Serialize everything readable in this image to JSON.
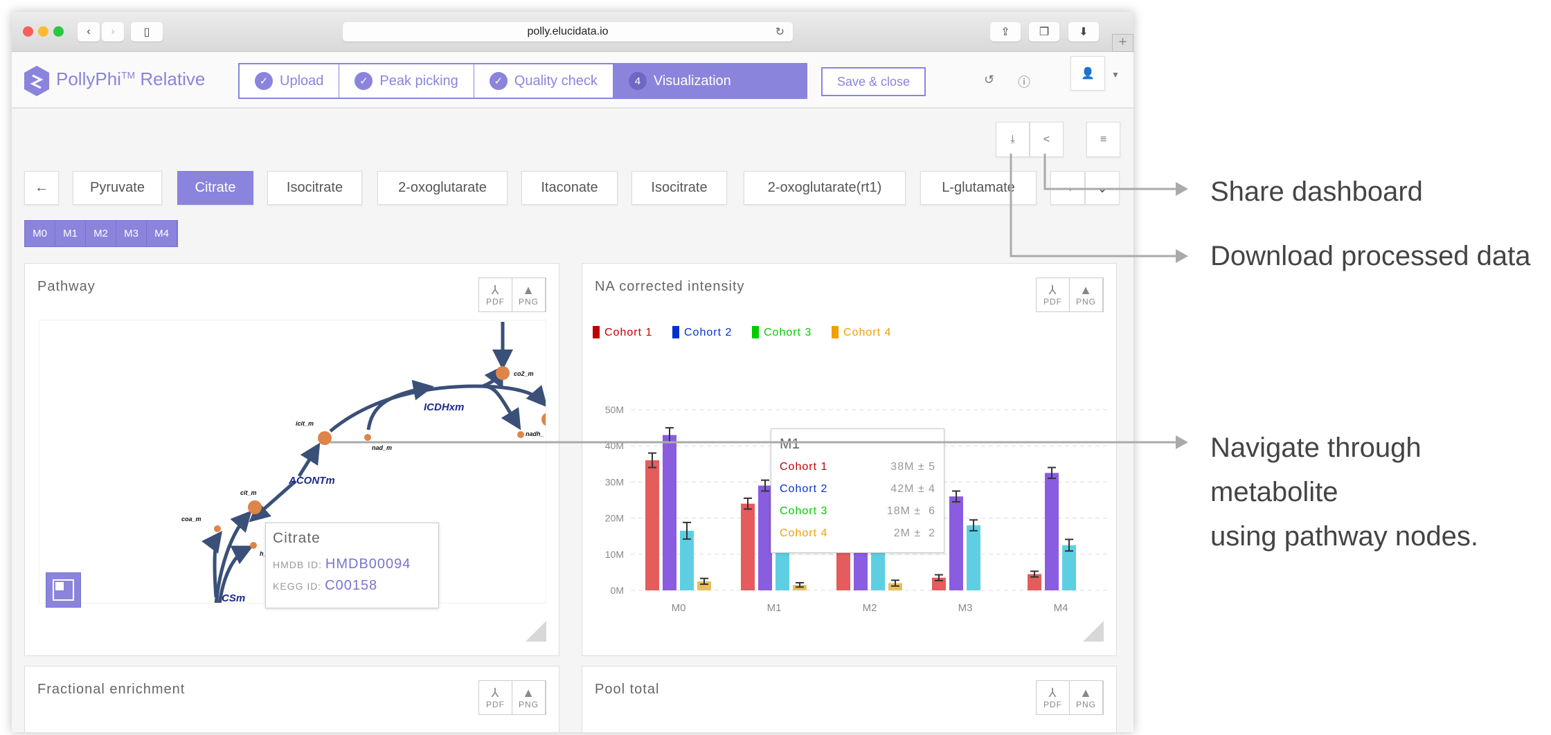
{
  "browser": {
    "url": "polly.elucidata.io",
    "icons": [
      "back-icon",
      "forward-icon",
      "sidebar-icon",
      "reload-icon",
      "share-icon",
      "tabs-icon",
      "download-icon",
      "new-tab-icon"
    ]
  },
  "app": {
    "name": "PollyPhi",
    "sup": "TM",
    "suffix": "Relative",
    "brand_color": "#8a84dc"
  },
  "stepper": [
    {
      "label": "Upload",
      "state": "done"
    },
    {
      "label": "Peak picking",
      "state": "done"
    },
    {
      "label": "Quality check",
      "state": "done"
    },
    {
      "num": "4",
      "label": "Visualization",
      "state": "active"
    }
  ],
  "save_label": "Save & close",
  "metabolites": {
    "items": [
      "Pyruvate",
      "Citrate",
      "Isocitrate",
      "2-oxoglutarate",
      "Itaconate",
      "Isocitrate",
      "2-oxoglutarate(rt1)",
      "L-glutamate"
    ],
    "selected": "Citrate"
  },
  "isotopologues": [
    "M0",
    "M1",
    "M2",
    "M3",
    "M4"
  ],
  "export": {
    "pdf": "PDF",
    "png": "PNG"
  },
  "pathway": {
    "title": "Pathway",
    "nodes": [
      "co2_m",
      "icit_m",
      "cit_m",
      "nad_m",
      "nadh_",
      "coa_m",
      "h_"
    ],
    "reactions": [
      "ICDHxm",
      "ACONTm",
      "CSm"
    ],
    "tooltip": {
      "name": "Citrate",
      "hmdb_label": "HMDB ID:",
      "hmdb": "HMDB00094",
      "kegg_label": "KEGG ID:",
      "kegg": "C00158"
    }
  },
  "na_chart": {
    "title": "NA corrected intensity",
    "tooltip": {
      "title": "M1",
      "rows": [
        {
          "name": "Cohort 1",
          "value": "38M ± 5"
        },
        {
          "name": "Cohort 2",
          "value": "42M ± 4"
        },
        {
          "name": "Cohort 3",
          "value": "18M ±  6"
        },
        {
          "name": "Cohort 4",
          "value": "2M ±  2"
        }
      ]
    }
  },
  "chart_data": {
    "type": "bar",
    "title": "NA corrected intensity",
    "categories": [
      "M0",
      "M1",
      "M2",
      "M3",
      "M4"
    ],
    "yticks": [
      "0M",
      "10M",
      "20M",
      "30M",
      "40M",
      "50M"
    ],
    "ylim": [
      0,
      50
    ],
    "grid": true,
    "legend": "top-left",
    "series": [
      {
        "name": "Cohort 1",
        "legend_color": "#c00000",
        "color": "#e55c5c",
        "values": [
          36,
          24,
          15,
          3.5,
          4.5
        ],
        "errors": [
          2,
          1.5,
          2,
          0.8,
          0.8
        ]
      },
      {
        "name": "Cohort 2",
        "legend_color": "#0033cc",
        "color": "#8a5ce0",
        "values": [
          43,
          29,
          22,
          26,
          32.5
        ],
        "errors": [
          2,
          1.5,
          2,
          1.5,
          1.5
        ]
      },
      {
        "name": "Cohort 3",
        "legend_color": "#00cc00",
        "color": "#5ecfe3",
        "values": [
          16.5,
          14,
          20,
          18,
          12.5
        ],
        "errors": [
          2.3,
          2,
          2,
          1.5,
          1.6
        ]
      },
      {
        "name": "Cohort 4",
        "legend_color": "#f0a000",
        "color": "#e8c060",
        "values": [
          2.5,
          1.5,
          2,
          0,
          0
        ],
        "errors": [
          0.8,
          0.6,
          0.8,
          0,
          0
        ]
      }
    ]
  },
  "bottom_panels": [
    "Fractional enrichment",
    "Pool total"
  ],
  "annotations": {
    "share": "Share dashboard",
    "download": "Download processed data",
    "navigate1": "Navigate through metabolite",
    "navigate2": "using pathway nodes."
  }
}
